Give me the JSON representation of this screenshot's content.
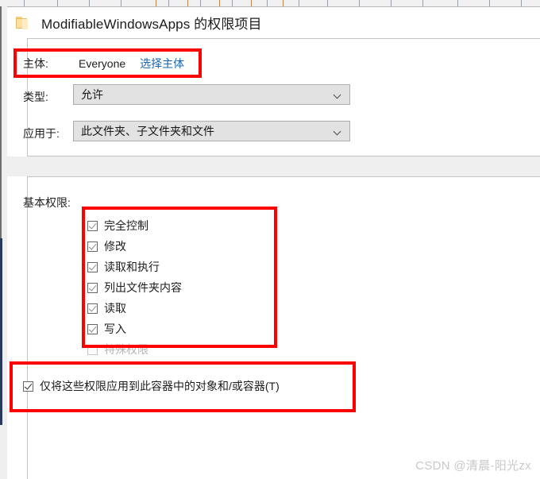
{
  "window": {
    "title": "ModifiableWindowsApps 的权限项目",
    "folder_icon": "folder-icon"
  },
  "subject": {
    "label": "主体:",
    "value": "Everyone",
    "select_link": "选择主体"
  },
  "type_field": {
    "label": "类型:",
    "value": "允许",
    "chevron_icon": "chevron-down-icon"
  },
  "applies_to_field": {
    "label": "应用于:",
    "value": "此文件夹、子文件夹和文件",
    "chevron_icon": "chevron-down-icon"
  },
  "basic_permissions": {
    "label": "基本权限:",
    "items": [
      {
        "label": "完全控制",
        "checked": true,
        "disabled": false
      },
      {
        "label": "修改",
        "checked": true,
        "disabled": false
      },
      {
        "label": "读取和执行",
        "checked": true,
        "disabled": false
      },
      {
        "label": "列出文件夹内容",
        "checked": true,
        "disabled": false
      },
      {
        "label": "读取",
        "checked": true,
        "disabled": false
      },
      {
        "label": "写入",
        "checked": true,
        "disabled": false
      },
      {
        "label": "特殊权限",
        "checked": false,
        "disabled": true
      }
    ]
  },
  "container_option": {
    "label": "仅将这些权限应用到此容器中的对象和/或容器(T)",
    "checked": true
  },
  "annotations": {
    "color": "#fe0000",
    "boxes": [
      {
        "name": "subject-row-highlight"
      },
      {
        "name": "basic-permissions-highlight"
      },
      {
        "name": "container-option-highlight"
      }
    ]
  },
  "watermark": {
    "text": "CSDN @清晨-阳光zx"
  },
  "colors": {
    "link": "#1767b5",
    "panel_bg": "#ffffff",
    "dialog_bg": "#efefef",
    "combo_bg": "#e2e2e2",
    "annotation_red": "#fe0000"
  }
}
